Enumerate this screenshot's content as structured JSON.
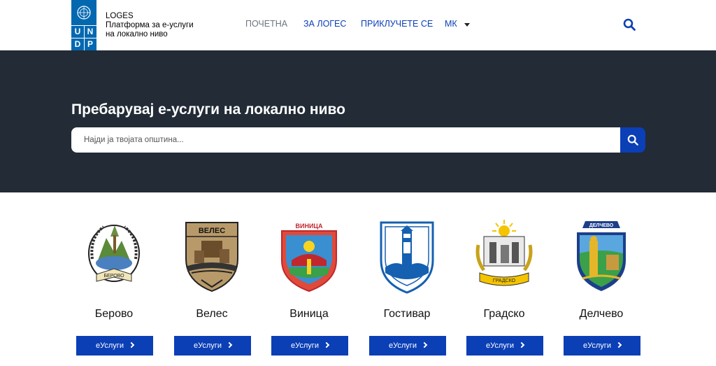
{
  "header": {
    "brand_line1": "LOGES",
    "brand_line2": "Платформа за е-услуги",
    "brand_line3": "на локално ниво",
    "undp_letters": [
      "U",
      "N",
      "D",
      "P"
    ],
    "nav": {
      "home": "ПОЧЕТНА",
      "about": "ЗА ЛОГЕС",
      "join": "ПРИКЛУЧЕТЕ СЕ",
      "lang": "МК"
    }
  },
  "hero": {
    "title": "Пребарувај е-услуги на локално ниво",
    "search_placeholder": "Најди ја твојата општина..."
  },
  "municipalities": [
    {
      "name": "Берово",
      "button": "еУслуги",
      "crest_text": "БЕРОВО"
    },
    {
      "name": "Велес",
      "button": "еУслуги",
      "crest_text": "ВЕЛЕС"
    },
    {
      "name": "Виница",
      "button": "еУслуги",
      "crest_text": "ВИНИЦА"
    },
    {
      "name": "Гостивар",
      "button": "еУслуги",
      "crest_text": ""
    },
    {
      "name": "Градско",
      "button": "еУслуги",
      "crest_text": "ГРАДСКО"
    },
    {
      "name": "Делчево",
      "button": "еУслуги",
      "crest_text": "ДЕЛЧЕВО"
    }
  ],
  "colors": {
    "primary": "#0b3fb6",
    "undp_blue": "#0468b1",
    "hero_bg": "#222b36"
  }
}
